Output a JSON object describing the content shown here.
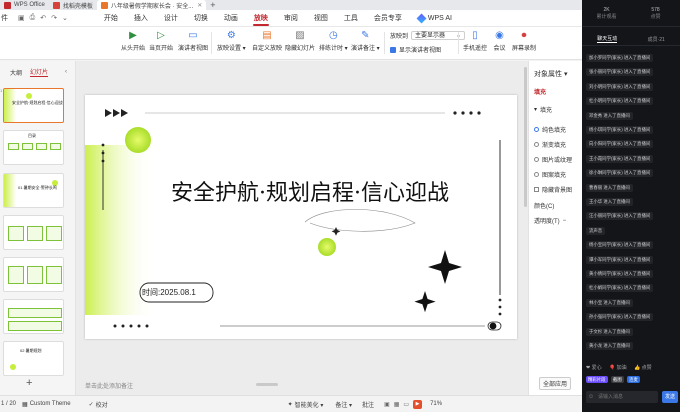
{
  "titlebar": {
    "tabs": [
      {
        "label": "WPS Office",
        "icon": "wps-logo-icon",
        "color": "#c2282d"
      },
      {
        "label": "找稻壳模板",
        "icon": "docer-icon",
        "color": "#d6413a"
      },
      {
        "label": "八年级暑假学期家长会 · 安全...",
        "icon": "ppt-file-icon",
        "color": "#e8762c"
      }
    ],
    "new_tab": "+"
  },
  "menubar": {
    "file": "件",
    "quick_access": [
      "▣",
      "⎙",
      "↶",
      "↷",
      "⌄"
    ],
    "items": [
      "开始",
      "插入",
      "设计",
      "切换",
      "动画",
      "放映",
      "审阅",
      "视图",
      "工具",
      "会员专享"
    ],
    "active": "放映",
    "wps_ai": "WPS AI"
  },
  "ribbon": {
    "buttons": [
      {
        "id": "from-start",
        "label": "从头开始",
        "icon": "play-icon"
      },
      {
        "id": "from-current",
        "label": "当页开始",
        "icon": "play-current-icon"
      },
      {
        "id": "presenter-view",
        "label": "演讲者视图",
        "icon": "presenter-icon"
      },
      {
        "id": "show-settings",
        "label": "放映设置 ▾",
        "icon": "settings-icon"
      },
      {
        "id": "custom-show",
        "label": "自定义放映",
        "icon": "custom-show-icon"
      },
      {
        "id": "hide-slide",
        "label": "隐藏幻灯片",
        "icon": "hide-slide-icon"
      },
      {
        "id": "rehearse",
        "label": "排练计时 ▾",
        "icon": "timer-icon"
      },
      {
        "id": "speaker-notes",
        "label": "演讲备注 ▾",
        "icon": "notes-icon"
      },
      {
        "id": "phone-remote",
        "label": "手机遥控",
        "icon": "phone-icon"
      },
      {
        "id": "meeting",
        "label": "会议",
        "icon": "meeting-icon"
      },
      {
        "id": "screen-record",
        "label": "屏幕录制",
        "icon": "record-icon"
      }
    ],
    "show_to_label": "放映到",
    "show_to_value": "主要显示器",
    "presenter_checkbox_label": "显示演讲者视图"
  },
  "left_panel": {
    "tabs": [
      "大纲",
      "幻灯片"
    ],
    "active_tab": "幻灯片",
    "thumbnails": [
      {
        "n": 1,
        "title": "安全护航·规划启程·信心迎战"
      },
      {
        "n": 2,
        "title": "目录"
      },
      {
        "n": 3,
        "title": "01 暑期安全·警钟长鸣"
      },
      {
        "n": 4,
        "title": ""
      },
      {
        "n": 5,
        "title": ""
      },
      {
        "n": 6,
        "title": ""
      },
      {
        "n": 7,
        "title": ""
      },
      {
        "n": 8,
        "title": "02 暑期规划"
      }
    ],
    "add": "+"
  },
  "slide": {
    "title": "安全护航·规划启程·信心迎战",
    "date": "时间:2025.08.1",
    "accent": "#c6ee3d"
  },
  "notes_placeholder": "单击此处添加备注",
  "props_pane": {
    "header": "对象属性 ▾",
    "section": "填充",
    "sub": "填充",
    "options": [
      "纯色填充",
      "渐变填充",
      "图片或纹理",
      "图案填充",
      "隐藏背景图"
    ],
    "selected": "纯色填充",
    "color_label": "颜色(C)",
    "transparency_label": "透明度(T)",
    "transparency_value": "0%",
    "apply_all": "全部应用"
  },
  "statusbar": {
    "slide_counter": "1 / 20",
    "theme": "Custom Theme",
    "proof": "校对",
    "beautify": "智能美化 ▾",
    "notes": "备注 ▾",
    "comment": "批注",
    "zoom": "71%"
  },
  "chat_panel": {
    "stats": [
      {
        "value": "2K",
        "label": "累计观看"
      },
      {
        "value": "578",
        "label": "点赞"
      }
    ],
    "tabs": [
      "聊天互动",
      "成员·21"
    ],
    "active_tab": "聊天互动",
    "messages": [
      "加小罗同学(家长) 进入了直播间",
      "张小丽同学(家长) 进入了直播间",
      "刘小明同学(家长) 进入了直播间",
      "杜小明同学(家长) 进入了直播间",
      "邓金秀 进入了直播间",
      "杨小琪同学(家长) 进入了直播间",
      "向小阳同学(家长) 进入了直播间",
      "王小霞同学(家长) 进入了直播间",
      "徐小琳同学(家长) 进入了直播间",
      "曹春丽 进入了直播间",
      "王小华 进入了直播间",
      "汪小丽同学(家长) 进入了直播间",
      "流声音",
      "杨小宝同学(家长) 进入了直播间",
      "谭小军同学(家长) 进入了直播间",
      "黄小倩同学(家长) 进入了直播间",
      "杜小娟同学(家长) 进入了直播间",
      "林小宝 进入了直播间",
      "孙小强同学(家长) 进入了直播间",
      "于文杉 进入了直播间",
      "黄小龙 进入了直播间"
    ],
    "gifts": [
      "❤ 爱心",
      "🎈 加油",
      "👍 点赞"
    ],
    "chips": [
      "精彩片段",
      "截图",
      "连麦"
    ],
    "input_placeholder": "请输入消息",
    "send": "发送"
  }
}
